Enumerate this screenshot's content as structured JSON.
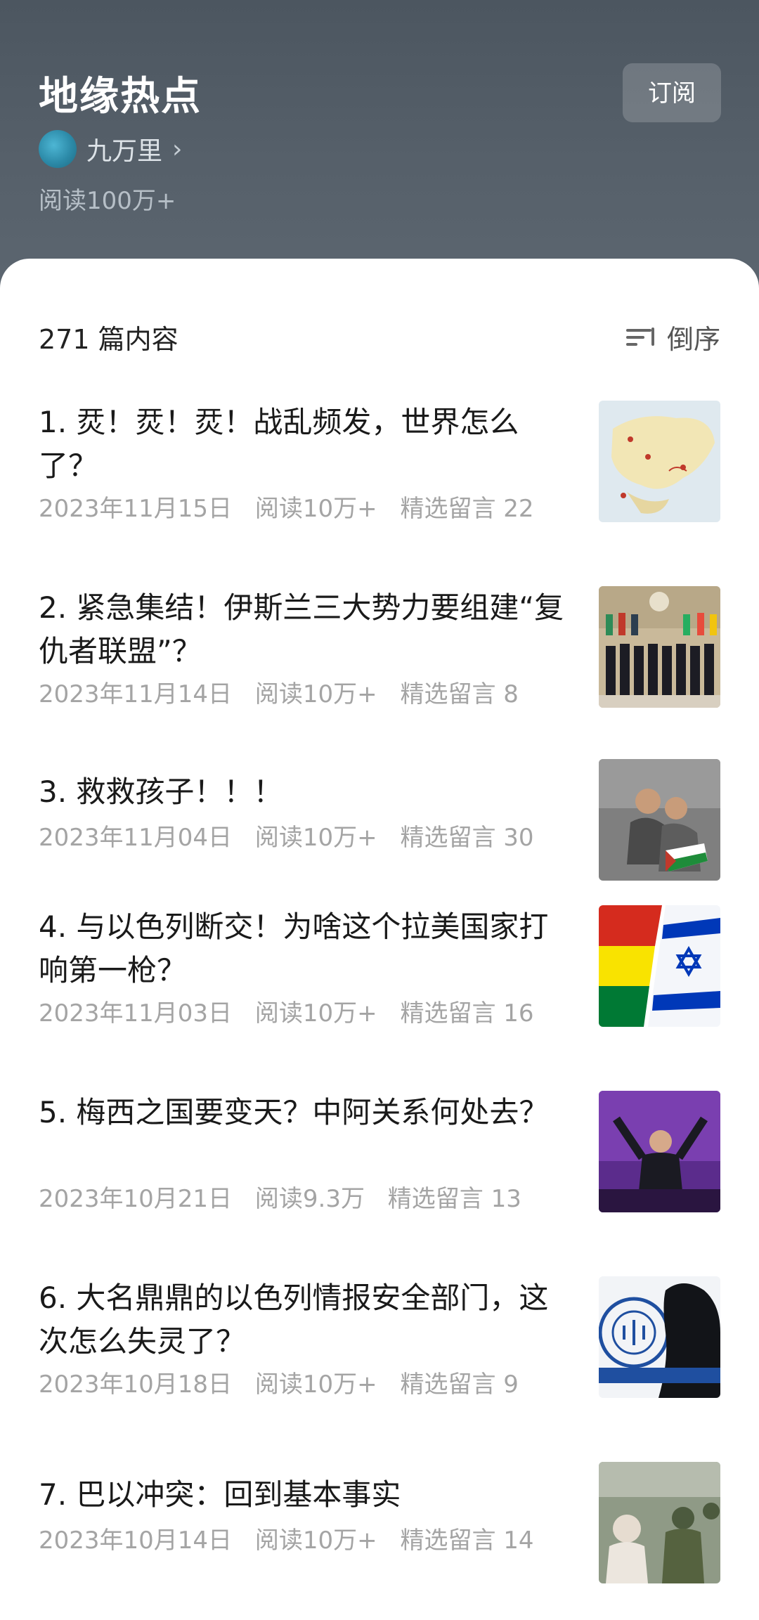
{
  "header": {
    "title": "地缘热点",
    "subscribe_label": "订阅",
    "author_name": "九万里",
    "reads": "阅读100万+"
  },
  "list": {
    "count_label": "271 篇内容",
    "sort_label": "倒序",
    "items": [
      {
        "title": "1. 烎！烎！烎！战乱频发，世界怎么了？",
        "date": "2023年11月15日",
        "reads": "阅读10万+",
        "comments": "精选留言 22",
        "thumb": "map-image"
      },
      {
        "title": "2. 紧急集结！伊斯兰三大势力要组建“复仇者联盟”？",
        "date": "2023年11月14日",
        "reads": "阅读10万+",
        "comments": "精选留言 8",
        "thumb": "summit-photo"
      },
      {
        "title": "3. 救救孩子！！！",
        "date": "2023年11月04日",
        "reads": "阅读10万+",
        "comments": "精选留言 30",
        "thumb": "children-photo"
      },
      {
        "title": "4. 与以色列断交！为啥这个拉美国家打响第一枪？",
        "date": "2023年11月03日",
        "reads": "阅读10万+",
        "comments": "精选留言 16",
        "thumb": "flags-image"
      },
      {
        "title": "5. 梅西之国要变天？中阿关系何处去？",
        "date": "2023年10月21日",
        "reads": "阅读9.3万",
        "comments": "精选留言 13",
        "thumb": "rally-photo"
      },
      {
        "title": "6. 大名鼎鼎的以色列情报安全部门，这次怎么失灵了？",
        "date": "2023年10月18日",
        "reads": "阅读10万+",
        "comments": "精选留言 9",
        "thumb": "emblem-image"
      },
      {
        "title": "7. 巴以冲突：回到基本事实",
        "date": "2023年10月14日",
        "reads": "阅读10万+",
        "comments": "精选留言 14",
        "thumb": "soldiers-photo"
      }
    ]
  },
  "colors": {
    "header_bg": "#4c5660",
    "sheet_bg": "#ffffff",
    "title_text": "#1a1a1a",
    "meta_text": "#a4a4a4"
  }
}
